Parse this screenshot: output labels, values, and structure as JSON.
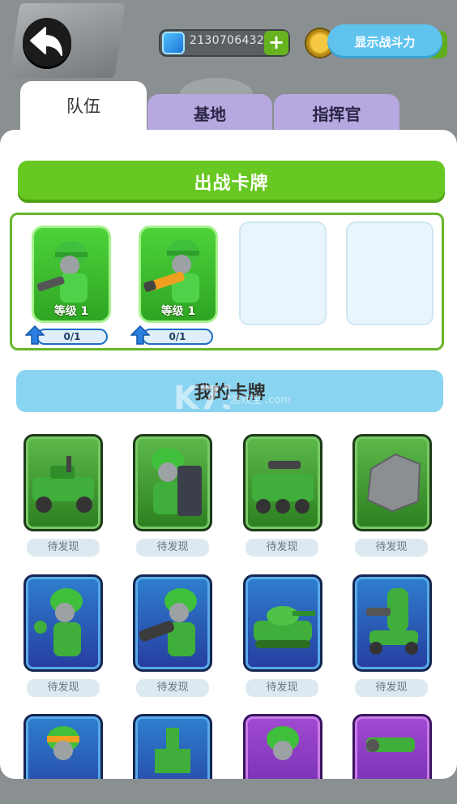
{
  "header": {
    "gems_value": "2130706432",
    "power_button_label": "显示战斗力"
  },
  "tabs": [
    {
      "label": "队伍",
      "active": true
    },
    {
      "label": "基地",
      "active": false
    },
    {
      "label": "指挥官",
      "active": false
    }
  ],
  "deck": {
    "title": "出战卡牌",
    "cards": [
      {
        "name": "rifle-soldier",
        "level_label": "等级 1",
        "progress": "0/1"
      },
      {
        "name": "bazooka-soldier",
        "level_label": "等级 1",
        "progress": "0/1"
      }
    ],
    "empty_slots": 2
  },
  "collection": {
    "title": "我的卡牌",
    "status_label": "待发现",
    "rows": [
      {
        "rarity": "green",
        "items": [
          "jeep-gunner",
          "shield-soldier",
          "missile-truck",
          "stone-block"
        ]
      },
      {
        "rarity": "blue",
        "items": [
          "grenade-soldier",
          "mortar-soldier",
          "tank",
          "turret-soldier"
        ]
      }
    ],
    "partial_row": [
      {
        "rarity": "blue",
        "item": "headband-soldier"
      },
      {
        "rarity": "blue",
        "item": "tower"
      },
      {
        "rarity": "purple",
        "item": "helmet-soldier"
      },
      {
        "rarity": "purple",
        "item": "cannon"
      }
    ]
  },
  "watermark": {
    "text": "游戏宝 .com",
    "brand": "K73"
  },
  "colors": {
    "green": "#67c821",
    "blue_header": "#89d4f0",
    "tab_inactive": "#b7a8e0",
    "power_button": "#5fc3ee"
  }
}
